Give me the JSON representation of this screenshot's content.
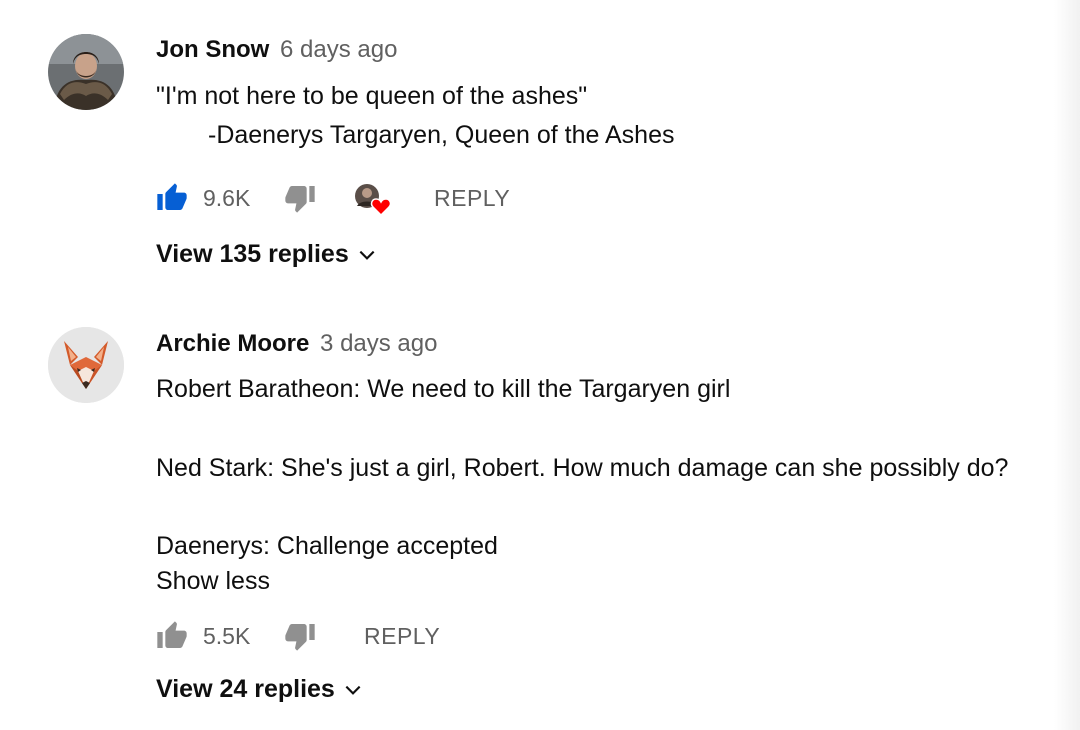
{
  "comments": [
    {
      "author": "Jon Snow",
      "time": "6 days ago",
      "lines": [
        "\"I'm not here to be queen of the ashes\"",
        "-Daenerys Targaryen, Queen of the Ashes"
      ],
      "likes": "9.6K",
      "liked": true,
      "creator_heart": true,
      "reply_label": "REPLY",
      "view_replies": "View 135 replies"
    },
    {
      "author": "Archie Moore",
      "time": "3 days ago",
      "lines": [
        "Robert Baratheon: We need to kill the Targaryen girl",
        "Ned Stark: She's just a girl, Robert. How much damage can she possibly do?",
        "Daenerys: Challenge accepted"
      ],
      "show_less": "Show less",
      "likes": "5.5K",
      "liked": false,
      "reply_label": "REPLY",
      "view_replies": "View 24 replies"
    }
  ],
  "icons": {
    "like": "thumbs-up-icon",
    "dislike": "thumbs-down-icon",
    "heart": "creator-heart-icon",
    "expand": "chevron-down-icon"
  },
  "colors": {
    "like_active": "#065fd4",
    "icon_inactive": "#909090",
    "heart": "#ff0000"
  }
}
